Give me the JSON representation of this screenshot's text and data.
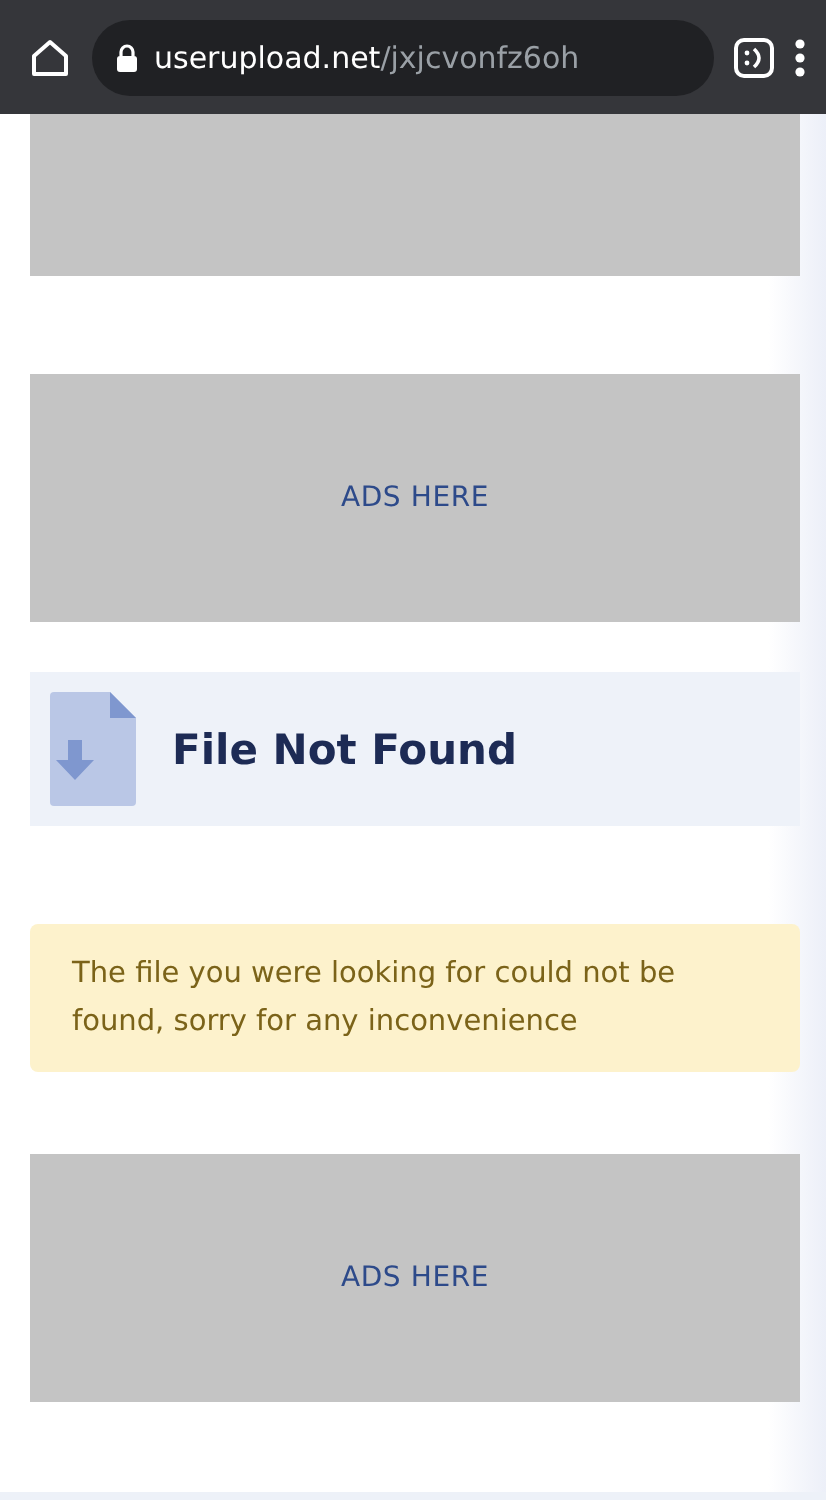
{
  "browser": {
    "domain": "userupload.net",
    "path": "/jxjcvonfz6oh"
  },
  "sections": [
    {
      "kind": "ad"
    },
    {
      "kind": "ad",
      "label": "ADS HERE"
    },
    {
      "kind": "file_header",
      "title": "File Not Found"
    },
    {
      "kind": "alert",
      "message": "The file you were looking for could not be found, sorry for any inconvenience"
    },
    {
      "kind": "ad",
      "label": "ADS HERE"
    }
  ]
}
